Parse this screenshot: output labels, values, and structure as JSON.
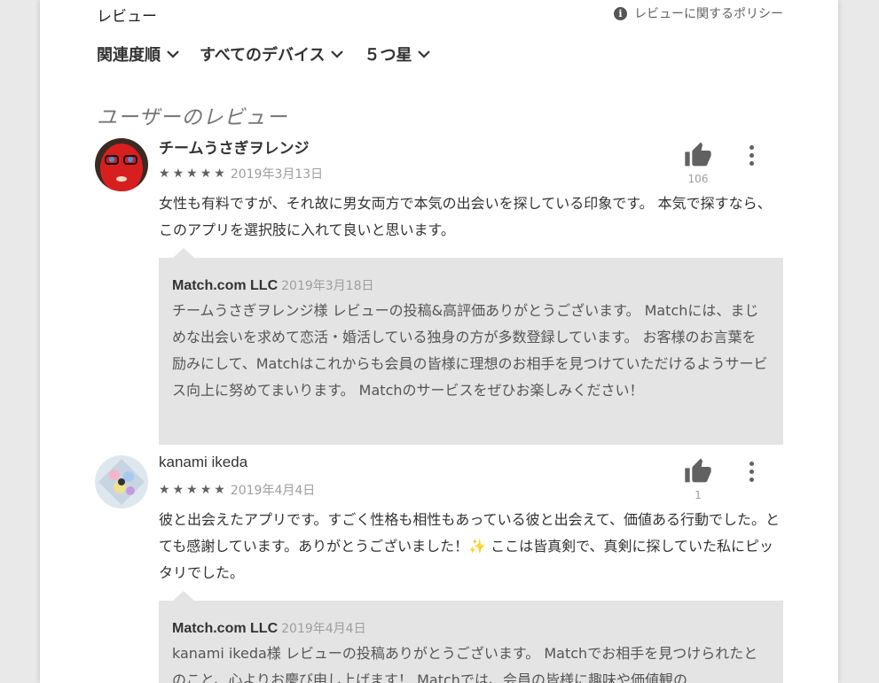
{
  "header": {
    "title": "レビュー",
    "policy_link": "レビューに関するポリシー",
    "policy_icon": "info-icon"
  },
  "filters": {
    "sort": "関連度順",
    "device": "すべてのデバイス",
    "rating": "５つ星"
  },
  "user_reviews_heading": "ユーザーのレビュー",
  "reviews": [
    {
      "author": "チームうさぎヲレンジ",
      "stars": 5,
      "date": "2019年3月13日",
      "helpful_count": "106",
      "text": "女性も有料ですが、それ故に男女両方で本気の出会いを探している印象です。 本気で探すなら、このアプリを選択肢に入れて良いと思います。",
      "reply": {
        "author": "Match.com LLC",
        "date": "2019年3月18日",
        "text": "チームうさぎヲレンジ様 レビューの投稿&高評価ありがとうございます。 Matchには、まじめな出会いを求めて恋活・婚活している独身の方が多数登録しています。 お客様のお言葉を励みにして、Matchはこれからも会員の皆様に理想のお相手を見つけていただけるようサービス向上に努めてまいります。 Matchのサービスをぜひお楽しみください！"
      }
    },
    {
      "author": "kanami ikeda",
      "stars": 5,
      "date": "2019年4月4日",
      "helpful_count": "1",
      "text": "彼と出会えたアプリです。すごく性格も相性もあっている彼と出会えて、価値ある行動でした。とても感謝しています。ありがとうございました！✨ ここは皆真剣で、真剣に探していた私にピッタリでした。",
      "reply": {
        "author": "Match.com LLC",
        "date": "2019年4月4日",
        "text": "kanami ikeda様 レビューの投稿ありがとうございます。 Matchでお相手を見つけられたとのこと、心よりお慶び申し上げます！ Matchでは、会員の皆様に趣味や価値観の"
      }
    }
  ],
  "colors": {
    "accent_gray": "#616161",
    "reply_bg": "#e4e4e4",
    "avatar1": "#d81f1f"
  }
}
